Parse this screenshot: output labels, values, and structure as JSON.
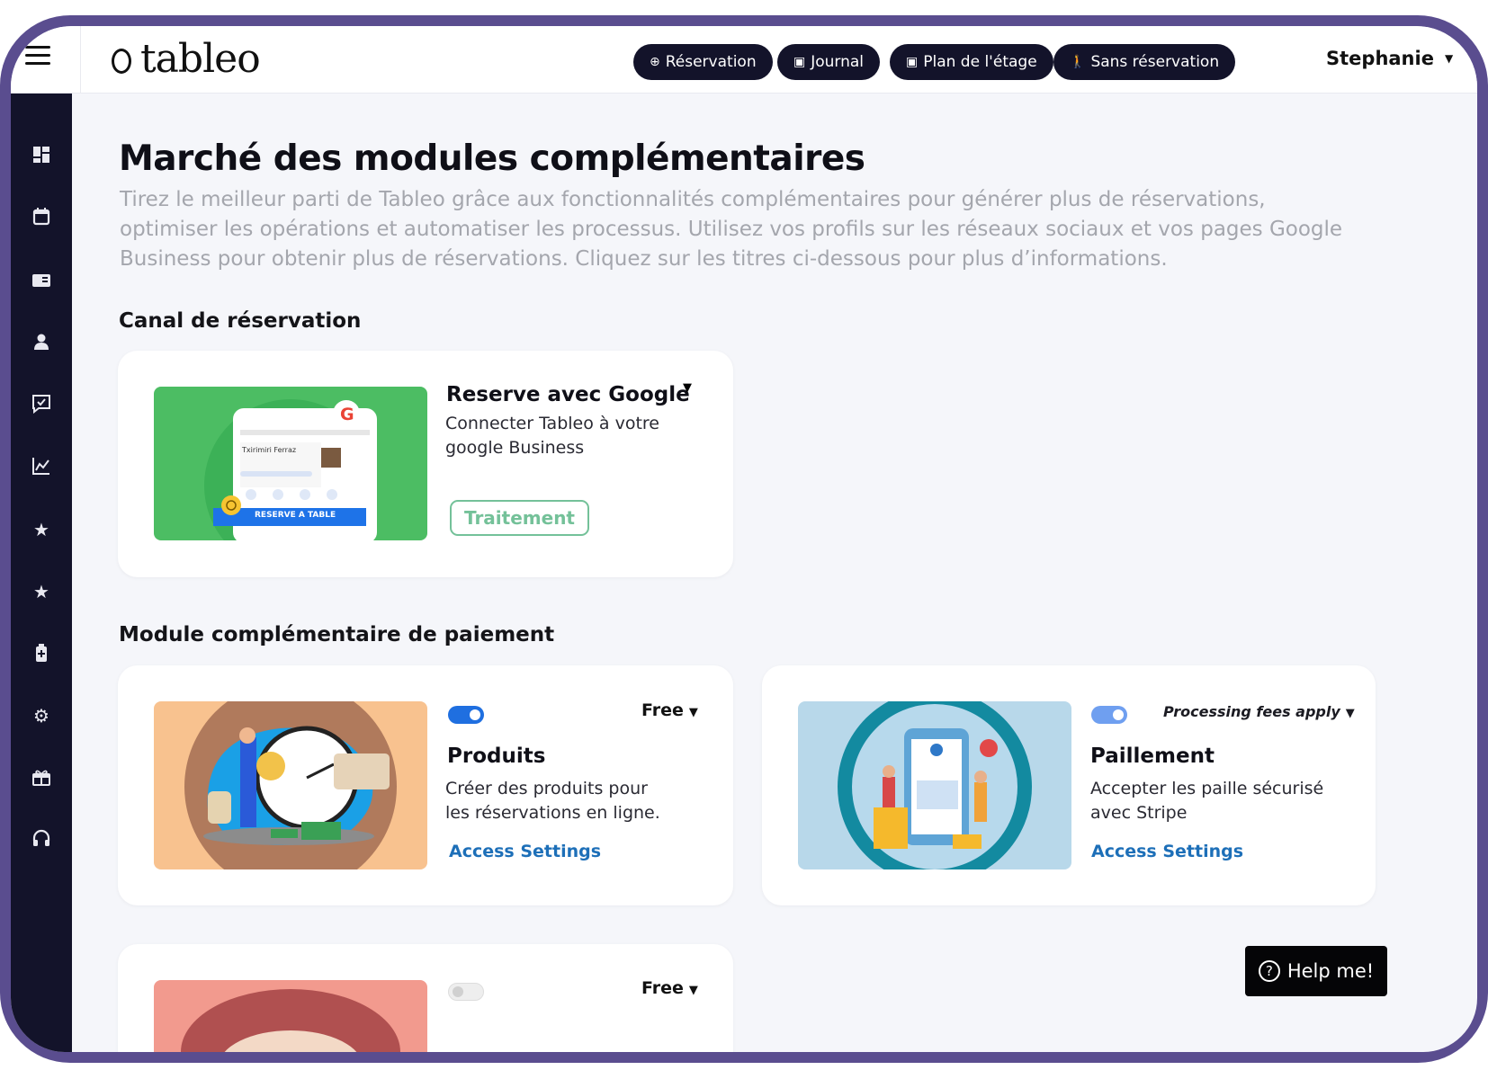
{
  "app": {
    "logo_text": "tableo"
  },
  "header": {
    "buttons": [
      {
        "icon": "plus-circle-icon",
        "label": "Réservation"
      },
      {
        "icon": "calendar-icon",
        "label": "Journal"
      },
      {
        "icon": "floor-plan-icon",
        "label": "Plan de l'étage"
      },
      {
        "icon": "walk-in-icon",
        "label": "Sans réservation"
      }
    ],
    "user_name": "Stephanie"
  },
  "sidebar": {
    "items": [
      {
        "icon": "dashboard-icon"
      },
      {
        "icon": "calendar-icon"
      },
      {
        "icon": "layout-icon"
      },
      {
        "icon": "guest-icon"
      },
      {
        "icon": "feedback-icon"
      },
      {
        "icon": "analytics-icon"
      },
      {
        "icon": "star-icon"
      },
      {
        "icon": "star-icon"
      },
      {
        "icon": "battery-icon"
      },
      {
        "icon": "settings-icon"
      },
      {
        "icon": "gift-icon"
      },
      {
        "icon": "headset-icon"
      }
    ]
  },
  "page": {
    "title": "Marché des modules complémentaires",
    "subtitle": "Tirez le meilleur parti de Tableo grâce aux fonctionnalités complémentaires pour générer plus de réservations, optimiser les opérations et automatiser les processus. Utilisez vos profils sur les réseaux sociaux et vos pages Google Business pour obtenir plus de réservations. Cliquez sur les titres ci-dessous pour plus d’informations."
  },
  "sections": [
    {
      "title": "Canal de réservation",
      "cards": [
        {
          "title": "Reserve avec Google",
          "description": "Connecter Tableo à votre google Business",
          "action_label": "Traitement",
          "image_text": {
            "listing_name": "Txirimiri Ferraz",
            "cta": "RESERVE A TABLE"
          }
        }
      ]
    },
    {
      "title": "Module complémentaire de paiement",
      "cards": [
        {
          "title": "Produits",
          "description": "Créer des produits pour les réservations en ligne.",
          "price": "Free",
          "link_label": "Access Settings",
          "toggle_on": true
        },
        {
          "title": "Paillement",
          "description": "Accepter les paille sécurisé avec Stripe",
          "price": "Processing fees apply",
          "link_label": "Access Settings",
          "toggle_on": true
        },
        {
          "price": "Free",
          "toggle_on": false
        }
      ]
    }
  ],
  "help": {
    "label": "Help me!"
  },
  "colors": {
    "frame": "#5a4d8f",
    "sidebar": "#13132a",
    "primary_button": "#13132a",
    "toggle_on": "#1f6fe0",
    "link": "#1d6fb8",
    "outline_green": "#74c199"
  }
}
